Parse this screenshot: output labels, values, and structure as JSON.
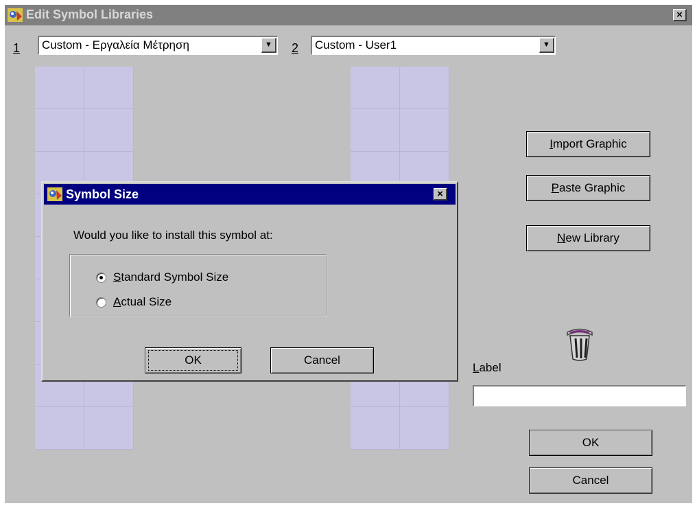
{
  "window": {
    "title": "Edit Symbol Libraries",
    "close_label": "×"
  },
  "libraries": [
    {
      "number": "1",
      "selected": "Custom - Εργαλεία Μέτρηση"
    },
    {
      "number": "2",
      "selected": "Custom - User1"
    }
  ],
  "buttons": {
    "import_graphic": {
      "hotkey": "I",
      "rest": "mport Graphic"
    },
    "paste_graphic": {
      "hotkey": "P",
      "rest": "aste Graphic"
    },
    "new_library": {
      "hotkey": "N",
      "rest": "ew Library"
    },
    "ok": "OK",
    "cancel": "Cancel"
  },
  "label_field": {
    "hotkey": "L",
    "rest": "abel",
    "value": ""
  },
  "dialog": {
    "title": "Symbol Size",
    "close_label": "×",
    "question": "Would you like to install this symbol at:",
    "options": [
      {
        "hotkey": "S",
        "rest": "tandard Symbol Size",
        "selected": true
      },
      {
        "hotkey": "A",
        "rest": "ctual Size",
        "selected": false
      }
    ],
    "ok": "OK",
    "cancel": "Cancel"
  },
  "icons": {
    "app": "app-icon",
    "trash": "trash-can-icon",
    "dropdown": "chevron-down-icon"
  },
  "colors": {
    "inactive_title": "#808080",
    "active_title": "#000080",
    "grid": "#c8c6e4",
    "face": "#c0c0c0"
  }
}
